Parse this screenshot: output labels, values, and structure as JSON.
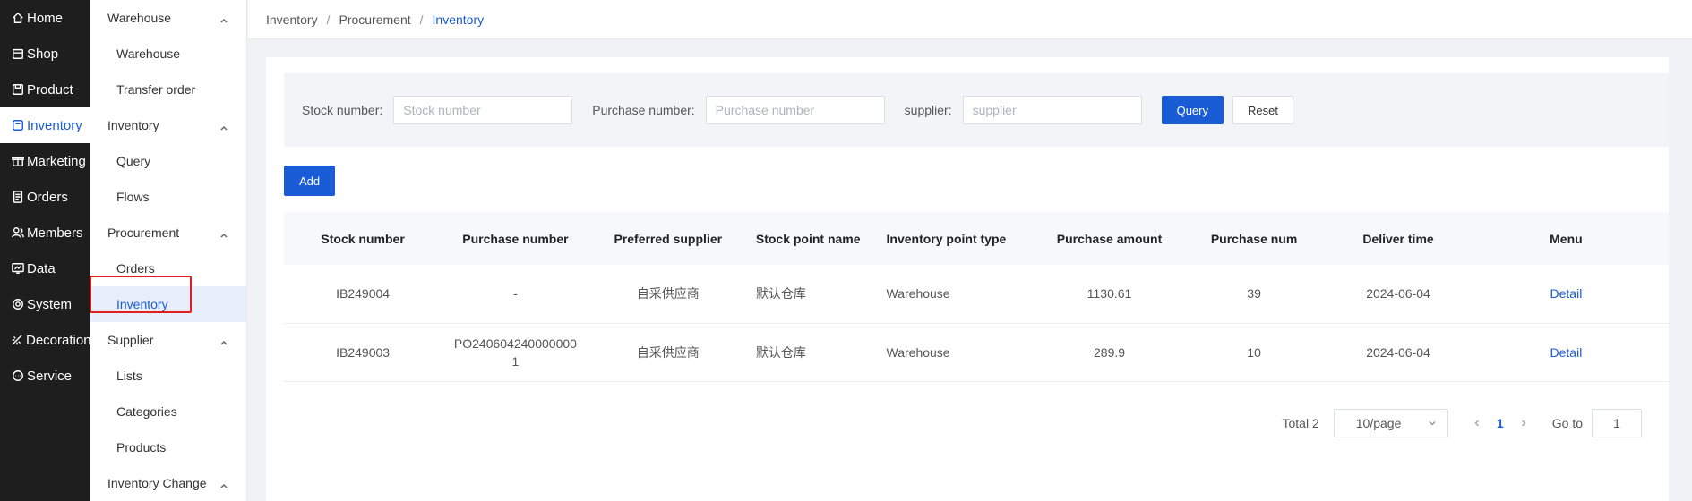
{
  "nav": {
    "items": [
      {
        "label": "Home",
        "icon": "home-icon"
      },
      {
        "label": "Shop",
        "icon": "shop-icon"
      },
      {
        "label": "Product",
        "icon": "product-icon"
      },
      {
        "label": "Inventory",
        "icon": "inventory-icon",
        "active": true
      },
      {
        "label": "Marketing",
        "icon": "gift-icon"
      },
      {
        "label": "Orders",
        "icon": "orders-icon"
      },
      {
        "label": "Members",
        "icon": "members-icon"
      },
      {
        "label": "Data",
        "icon": "data-icon"
      },
      {
        "label": "System",
        "icon": "gear-icon"
      },
      {
        "label": "Decoration",
        "icon": "decoration-icon"
      },
      {
        "label": "Service",
        "icon": "chat-icon"
      }
    ]
  },
  "subnav": {
    "groups": [
      {
        "label": "Warehouse",
        "items": [
          "Warehouse",
          "Transfer order"
        ]
      },
      {
        "label": "Inventory",
        "items": [
          "Query",
          "Flows"
        ]
      },
      {
        "label": "Procurement",
        "items": [
          "Orders",
          "Inventory"
        ]
      },
      {
        "label": "Supplier",
        "items": [
          "Lists",
          "Categories",
          "Products"
        ]
      },
      {
        "label": "Inventory Change",
        "items": []
      }
    ]
  },
  "breadcrumb": [
    "Inventory",
    "Procurement",
    "Inventory"
  ],
  "filter": {
    "stock_label": "Stock number:",
    "stock_placeholder": "Stock number",
    "purchase_label": "Purchase number:",
    "purchase_placeholder": "Purchase number",
    "supplier_label": "supplier:",
    "supplier_placeholder": "supplier",
    "query_label": "Query",
    "reset_label": "Reset"
  },
  "add_label": "Add",
  "table": {
    "headers": [
      "Stock number",
      "Purchase number",
      "Preferred supplier",
      "Stock point name",
      "Inventory point type",
      "Purchase amount",
      "Purchase num",
      "Deliver time",
      "Menu"
    ],
    "rows": [
      [
        "IB249004",
        "-",
        "自采供应商",
        "默认仓库",
        "Warehouse",
        "1130.61",
        "39",
        "2024-06-04",
        "Detail"
      ],
      [
        "IB249003",
        "PO2406042400000001",
        "自采供应商",
        "默认仓库",
        "Warehouse",
        "289.9",
        "10",
        "2024-06-04",
        "Detail"
      ]
    ]
  },
  "pagination": {
    "total": "Total 2",
    "page_size": "10/page",
    "current_page": "1",
    "goto_label": "Go to",
    "goto_value": "1"
  },
  "colors": {
    "accent": "#1a5bd6",
    "nav_bg": "#1e1e1e",
    "highlight": "#e02020"
  }
}
